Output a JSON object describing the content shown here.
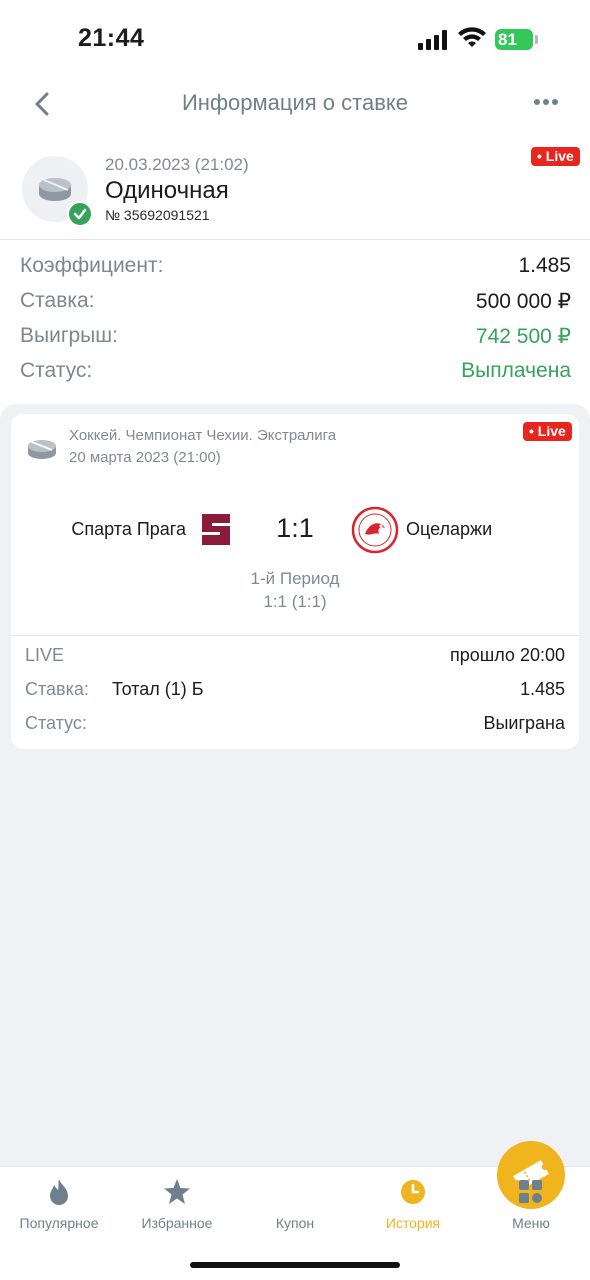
{
  "status_bar": {
    "time": "21:44",
    "battery": "81"
  },
  "nav": {
    "title": "Информация о ставке",
    "back_icon": "chevron-left-icon",
    "more_icon": "ellipsis-icon"
  },
  "bet": {
    "date": "20.03.2023 (21:02)",
    "type": "Одиночная",
    "number": "№ 35692091521",
    "live_badge": "• Live",
    "sport_icon": "hockey-puck-icon",
    "status_icon": "check-icon"
  },
  "summary": [
    {
      "label": "Коэффициент:",
      "value": "1.485"
    },
    {
      "label": "Ставка:",
      "value": "500 000 ₽"
    },
    {
      "label": "Выигрыш:",
      "value": "742 500 ₽"
    },
    {
      "label": "Статус:",
      "value": "Выплачена"
    }
  ],
  "event": {
    "league": "Хоккей. Чемпионат Чехии. Экстралига",
    "date": "20 марта 2023 (21:00)",
    "live_badge": "• Live",
    "team1": "Спарта Прага",
    "team2": "Оцеларжи",
    "score": "1:1",
    "period": "1-й Период",
    "period_score": "1:1 (1:1)",
    "live_label": "LIVE",
    "elapsed": "прошло 20:00",
    "bet_label": "Ставка:",
    "bet_market": "Тотал (1) Б",
    "bet_odds": "1.485",
    "status_label": "Статус:",
    "status_value": "Выиграна"
  },
  "tabs": [
    {
      "label": "Популярное",
      "icon": "flame-icon"
    },
    {
      "label": "Избранное",
      "icon": "star-icon"
    },
    {
      "label": "Купон",
      "icon": "ticket-icon"
    },
    {
      "label": "История",
      "icon": "clock-icon"
    },
    {
      "label": "Меню",
      "icon": "grid-icon"
    }
  ],
  "colors": {
    "accent": "#f0b51e",
    "success": "#35a35a",
    "live": "#e8261f",
    "nav_text": "#6e808c"
  }
}
